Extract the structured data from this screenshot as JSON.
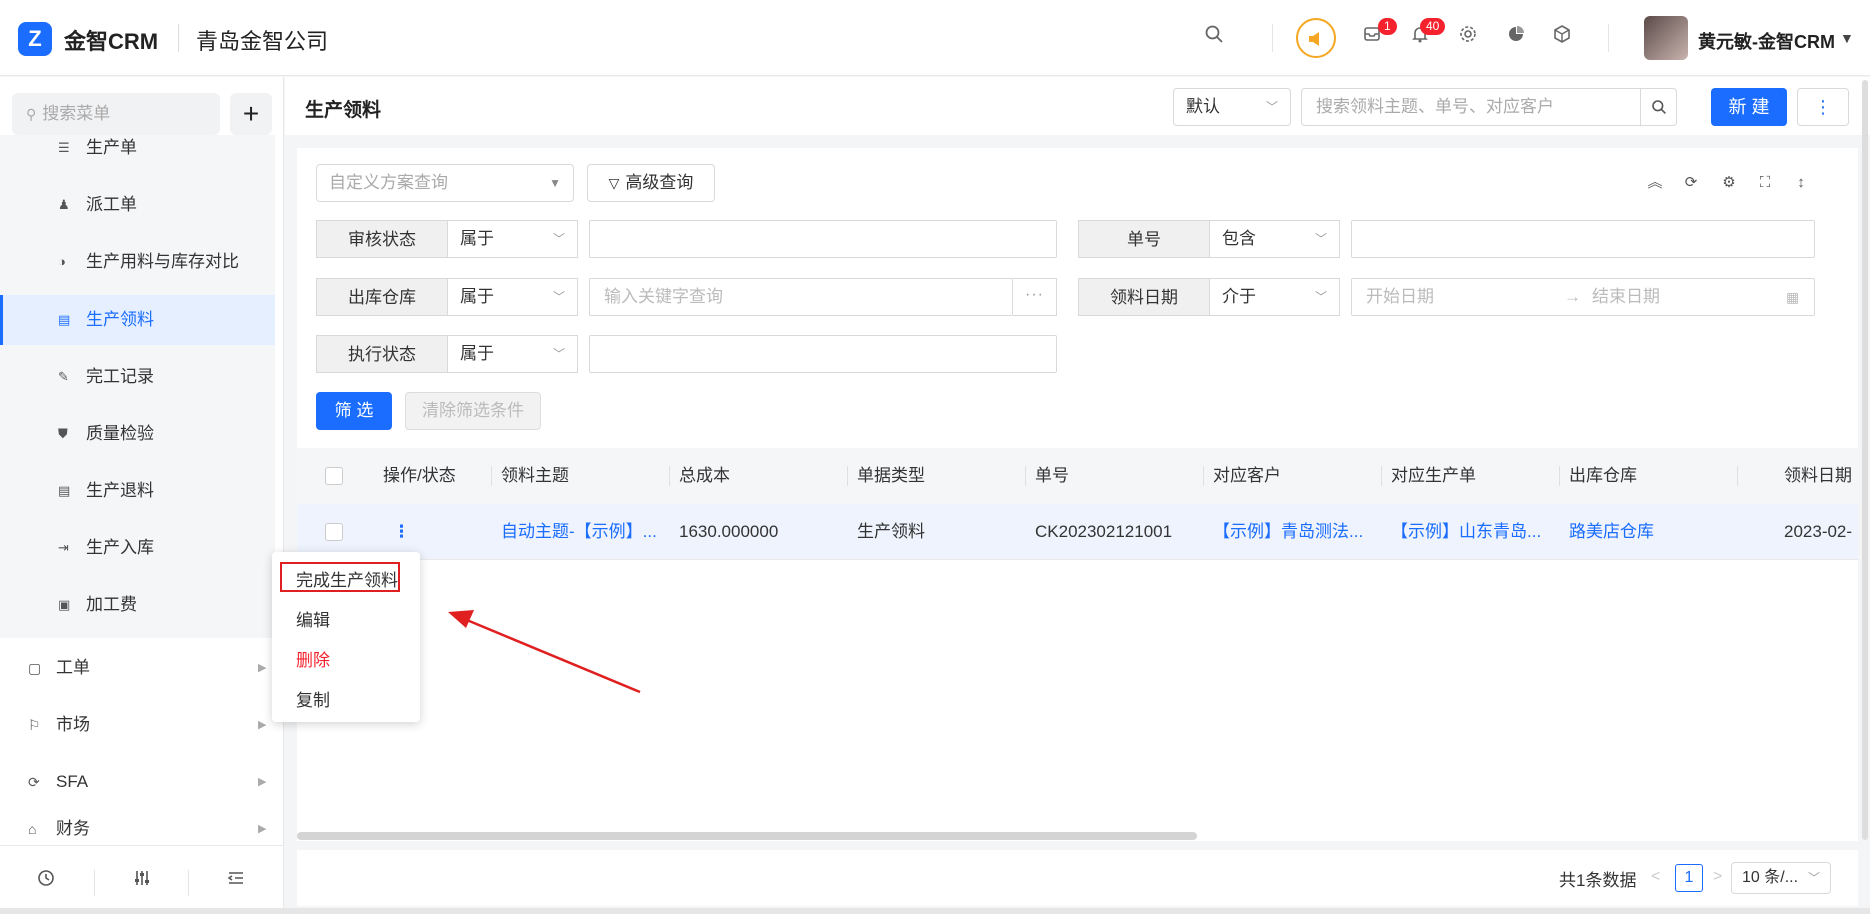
{
  "app": {
    "brand": "金智CRM",
    "company": "青岛金智公司",
    "logo_letter": "Z"
  },
  "topbar": {
    "icons": [
      "search-icon",
      "speaker-icon",
      "message-icon",
      "bell-icon",
      "gear-icon",
      "chart-icon",
      "cube-icon"
    ],
    "message_badge": "1",
    "bell_badge": "40",
    "username": "黄元敏-金智CRM"
  },
  "sidebar": {
    "search_placeholder": "搜索菜单",
    "items": [
      {
        "label": "生产单",
        "icon": "production-order-icon"
      },
      {
        "label": "派工单",
        "icon": "dispatch-icon"
      },
      {
        "label": "生产用料与库存对比",
        "icon": "compare-icon"
      },
      {
        "label": "生产领料",
        "icon": "document-icon",
        "active": true
      },
      {
        "label": "完工记录",
        "icon": "edit-icon"
      },
      {
        "label": "质量检验",
        "icon": "shield-icon"
      },
      {
        "label": "生产退料",
        "icon": "document-icon"
      },
      {
        "label": "生产入库",
        "icon": "import-icon"
      },
      {
        "label": "加工费",
        "icon": "fee-icon"
      }
    ],
    "groups": [
      {
        "label": "工单",
        "icon": "ticket-icon"
      },
      {
        "label": "市场",
        "icon": "flag-icon"
      },
      {
        "label": "SFA",
        "icon": "sfa-icon"
      },
      {
        "label": "财务",
        "icon": "finance-icon"
      }
    ]
  },
  "header": {
    "page_title": "生产领料",
    "view_select": "默认",
    "search_placeholder": "搜索领料主题、单号、对应客户",
    "new_button": "新 建",
    "more_button": "⋮"
  },
  "filter": {
    "scheme_placeholder": "自定义方案查询",
    "advanced_query": "高级查询",
    "rows": [
      {
        "label": "审核状态",
        "op": "属于",
        "value": ""
      },
      {
        "label": "单号",
        "op": "包含",
        "value": ""
      },
      {
        "label": "出库仓库",
        "op": "属于",
        "placeholder": "输入关键字查询"
      },
      {
        "label": "领料日期",
        "op": "介于",
        "start_placeholder": "开始日期",
        "end_placeholder": "结束日期"
      },
      {
        "label": "执行状态",
        "op": "属于",
        "value": ""
      }
    ],
    "filter_button": "筛 选",
    "clear_button": "清除筛选条件"
  },
  "table": {
    "columns": [
      "操作/状态",
      "领料主题",
      "总成本",
      "单据类型",
      "单号",
      "对应客户",
      "对应生产单",
      "出库仓库",
      "领料日期"
    ],
    "rows": [
      {
        "action": "⋮",
        "subject": "自动主题-【示例】...",
        "total_cost": "1630.000000",
        "doc_type": "生产领料",
        "number": "CK202302121001",
        "customer": "【示例】青岛测法...",
        "production_order": "【示例】山东青岛...",
        "warehouse": "路美店仓库",
        "date": "2023-02-"
      }
    ]
  },
  "pagination": {
    "total": "共1条数据",
    "current_page": "1",
    "page_size": "10 条/..."
  },
  "context_menu": {
    "items": [
      "完成生产领料",
      "编辑",
      "删除",
      "复制"
    ],
    "highlighted": "完成生产领料",
    "danger": "删除"
  },
  "colors": {
    "accent": "#1a6dff",
    "danger": "#f5222d",
    "annotation": "#e02020",
    "speaker": "#f5a623"
  }
}
